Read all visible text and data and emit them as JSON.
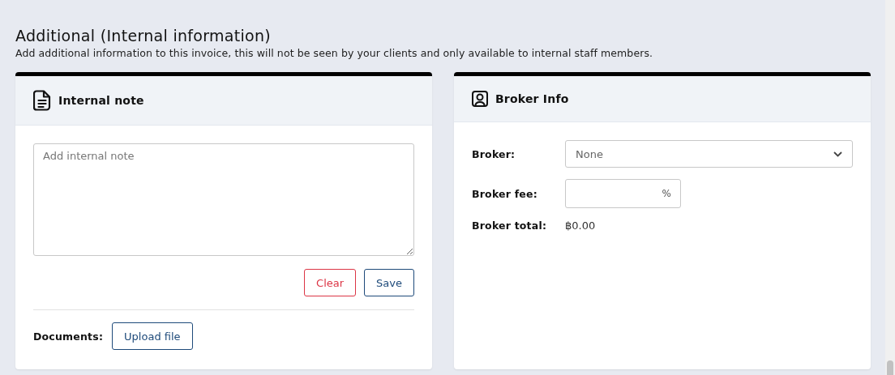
{
  "section": {
    "title": "Additional (Internal information)",
    "description": "Add additional information to this invoice, this will not be seen by your clients and only available to internal staff members."
  },
  "internal_note": {
    "title": "Internal note",
    "note_field": {
      "placeholder": "Add internal note"
    },
    "buttons": [
      {
        "label": "Clear",
        "kind": "danger"
      },
      {
        "label": "Save",
        "kind": "primary"
      }
    ],
    "documents_label": "Documents:",
    "upload_button": "Upload file"
  },
  "broker_info": {
    "title": "Broker Info",
    "fields": [
      {
        "label": "Broker:",
        "kind": "select",
        "value": "None"
      },
      {
        "label": "Broker fee:",
        "kind": "percent",
        "suffix": "%"
      },
      {
        "label": "Broker total:",
        "kind": "text",
        "value": "฿0.00"
      }
    ]
  }
}
